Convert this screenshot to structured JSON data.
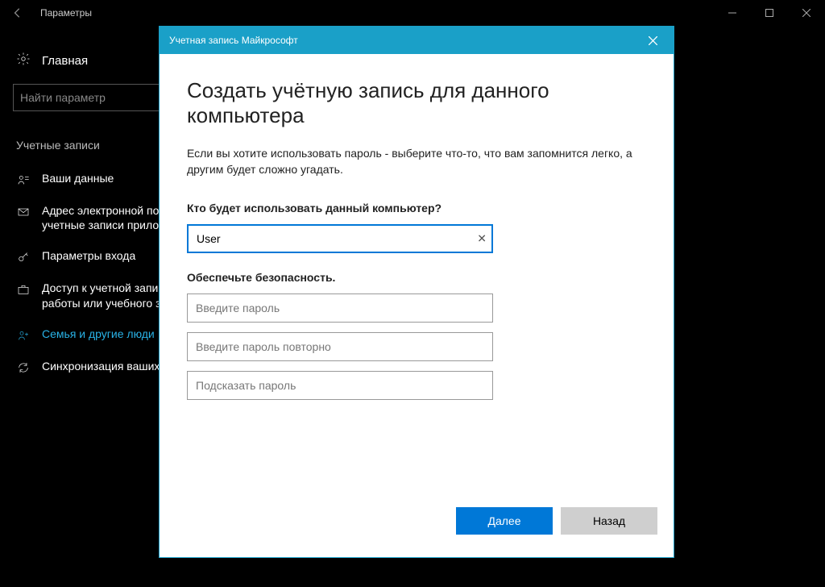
{
  "window": {
    "title": "Параметры"
  },
  "sidebar": {
    "home": "Главная",
    "search_placeholder": "Найти параметр",
    "section": "Учетные записи",
    "items": [
      {
        "label": "Ваши данные"
      },
      {
        "label": "Адрес электронной почты; учетные записи приложения"
      },
      {
        "label": "Параметры входа"
      },
      {
        "label": "Доступ к учетной записи места работы или учебного заведения"
      },
      {
        "label": "Семья и другие люди"
      },
      {
        "label": "Синхронизация ваших параметров"
      }
    ]
  },
  "dialog": {
    "header": "Учетная запись Майкрософт",
    "title": "Создать учётную запись для данного компьютера",
    "description": "Если вы хотите использовать пароль - выберите что-то, что вам запомнится легко, а другим будет сложно угадать.",
    "question": "Кто будет использовать данный компьютер?",
    "username_value": "User",
    "security_label": "Обеспечьте безопасность.",
    "password_placeholder": "Введите пароль",
    "password_confirm_placeholder": "Введите пароль повторно",
    "password_hint_placeholder": "Подсказать пароль",
    "next": "Далее",
    "back": "Назад"
  }
}
